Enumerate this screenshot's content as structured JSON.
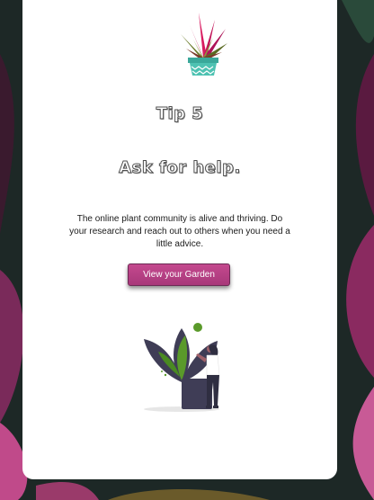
{
  "tip": {
    "number_label": "Tip 5",
    "headline": "Ask for help.",
    "body": "The online plant community is alive and thriving. Do your research and reach out to others when you need a little advice."
  },
  "actions": {
    "view_garden_label": "View your Garden"
  },
  "colors": {
    "accent": "#b63f84",
    "card_background": "#ffffff",
    "text": "#1a1a1a"
  },
  "icons": {
    "header_plant": "potted-plant-icon",
    "illustration": "person-with-plant-illustration"
  }
}
